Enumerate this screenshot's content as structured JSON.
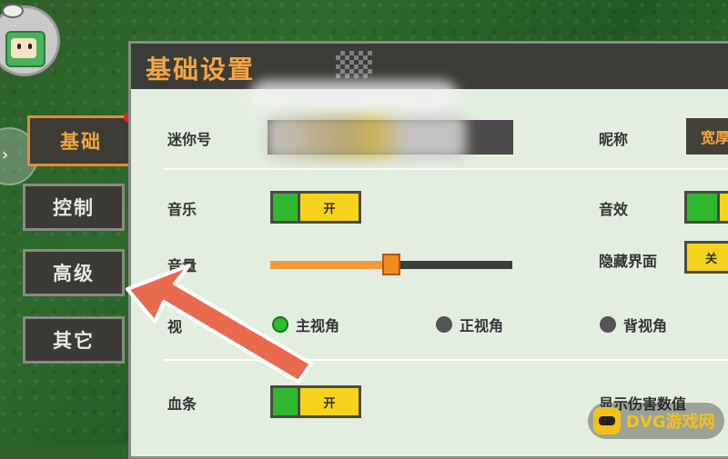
{
  "sidebar": {
    "tabs": [
      {
        "label": "基础",
        "active": true,
        "has_notification": true
      },
      {
        "label": "控制",
        "active": false
      },
      {
        "label": "高级",
        "active": false
      },
      {
        "label": "其它",
        "active": false
      }
    ]
  },
  "panel": {
    "title": "基础设置",
    "rows": {
      "mini_id": {
        "label": "迷你号"
      },
      "nickname": {
        "label": "昵称",
        "value": "宽厚"
      },
      "music": {
        "label": "音乐",
        "toggle": "开",
        "on": true
      },
      "sound_effect": {
        "label": "音效",
        "on": true
      },
      "volume": {
        "label": "音量",
        "level_fraction": 0.5
      },
      "hide_ui": {
        "label": "隐藏界面",
        "toggle": "关",
        "on": false
      },
      "view": {
        "label": "视",
        "options": [
          {
            "label": "主视角",
            "selected": true
          },
          {
            "label": "正视角",
            "selected": false
          },
          {
            "label": "背视角",
            "selected": false
          }
        ]
      },
      "health_bar": {
        "label": "血条",
        "toggle": "开",
        "on": true
      },
      "show_damage": {
        "label": "显示伤害数值"
      }
    }
  },
  "watermark": {
    "text": "DVG游戏网"
  },
  "colors": {
    "accent_orange": "#f5a544",
    "toggle_green": "#2fb82f",
    "toggle_yellow": "#f5d21b",
    "arrow_red": "#ea6a4e",
    "panel_bg": "#e3eee0"
  }
}
